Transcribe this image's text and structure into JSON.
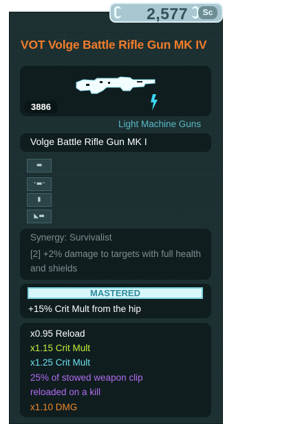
{
  "credits": {
    "amount": "2,577",
    "icon": "sc-credits-icon",
    "icon_text": "Sc"
  },
  "weapon": {
    "title": "VOT Volge Battle Rifle Gun MK IV",
    "power": "3886",
    "type": "Light Machine Guns",
    "name": "Volge Battle Rifle Gun MK I",
    "element_icon": "lightning-bolt-icon"
  },
  "mods": [
    "scope-mod-icon",
    "barrel-mod-icon",
    "magazine-mod-icon",
    "stock-mod-icon"
  ],
  "synergy": {
    "title": "Synergy: Survivalist",
    "description": "[2] +2% damage to targets with full health and shields"
  },
  "mastery": {
    "label": "MASTERED",
    "bonus": "+15% Crit Mult from the hip"
  },
  "stats": [
    {
      "text": "x0.95 Reload",
      "color": "#ffffff"
    },
    {
      "text": "x1.15 Crit Mult",
      "color": "#c5ef3a"
    },
    {
      "text": "x1.25 Crit Mult",
      "color": "#6ee0f0"
    },
    {
      "text": "25% of stowed weapon clip",
      "color": "#b26cf0"
    },
    {
      "text": "reloaded on a kill",
      "color": "#b26cf0"
    },
    {
      "text": "x1.10 DMG",
      "color": "#f28a2a"
    }
  ],
  "colors": {
    "title": "#f27c2a",
    "type": "#58b9c6",
    "panel": "#1b2f31",
    "box": "#0f1d1f"
  }
}
